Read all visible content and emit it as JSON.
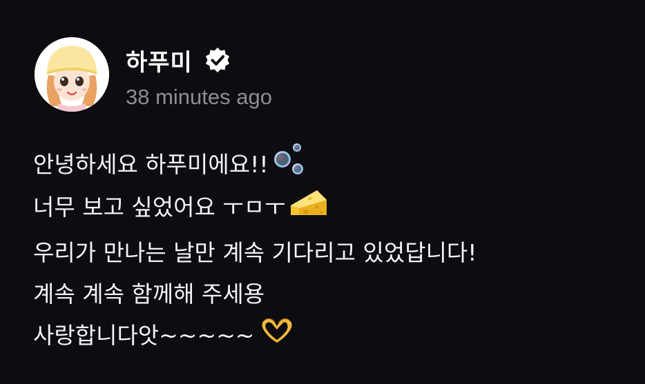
{
  "author": {
    "name": "하푸미",
    "verified": true,
    "avatar_icon": "cartoon-avatar-icon"
  },
  "timestamp": "38 minutes ago",
  "message": {
    "lines": [
      {
        "text": "안녕하세요 하푸미에요!!",
        "emoji": "bubbles-icon"
      },
      {
        "text": "너무 보고 싶었어요 ㅜㅁㅜ ",
        "emoji": "cheese-icon"
      },
      {
        "text": "우리가 만나는 날만 계속 기다리고 있었답니다!",
        "emoji": ""
      },
      {
        "text": "계속 계속 함께해 주세용",
        "emoji": ""
      },
      {
        "text": "사랑합니다앗~~~~~",
        "emoji": "heart-hands-icon"
      }
    ]
  },
  "colors": {
    "background": "#0d0c11",
    "text": "#f4f4f6",
    "timestamp": "#8e8e93",
    "verified_badge": "#ffffff"
  }
}
